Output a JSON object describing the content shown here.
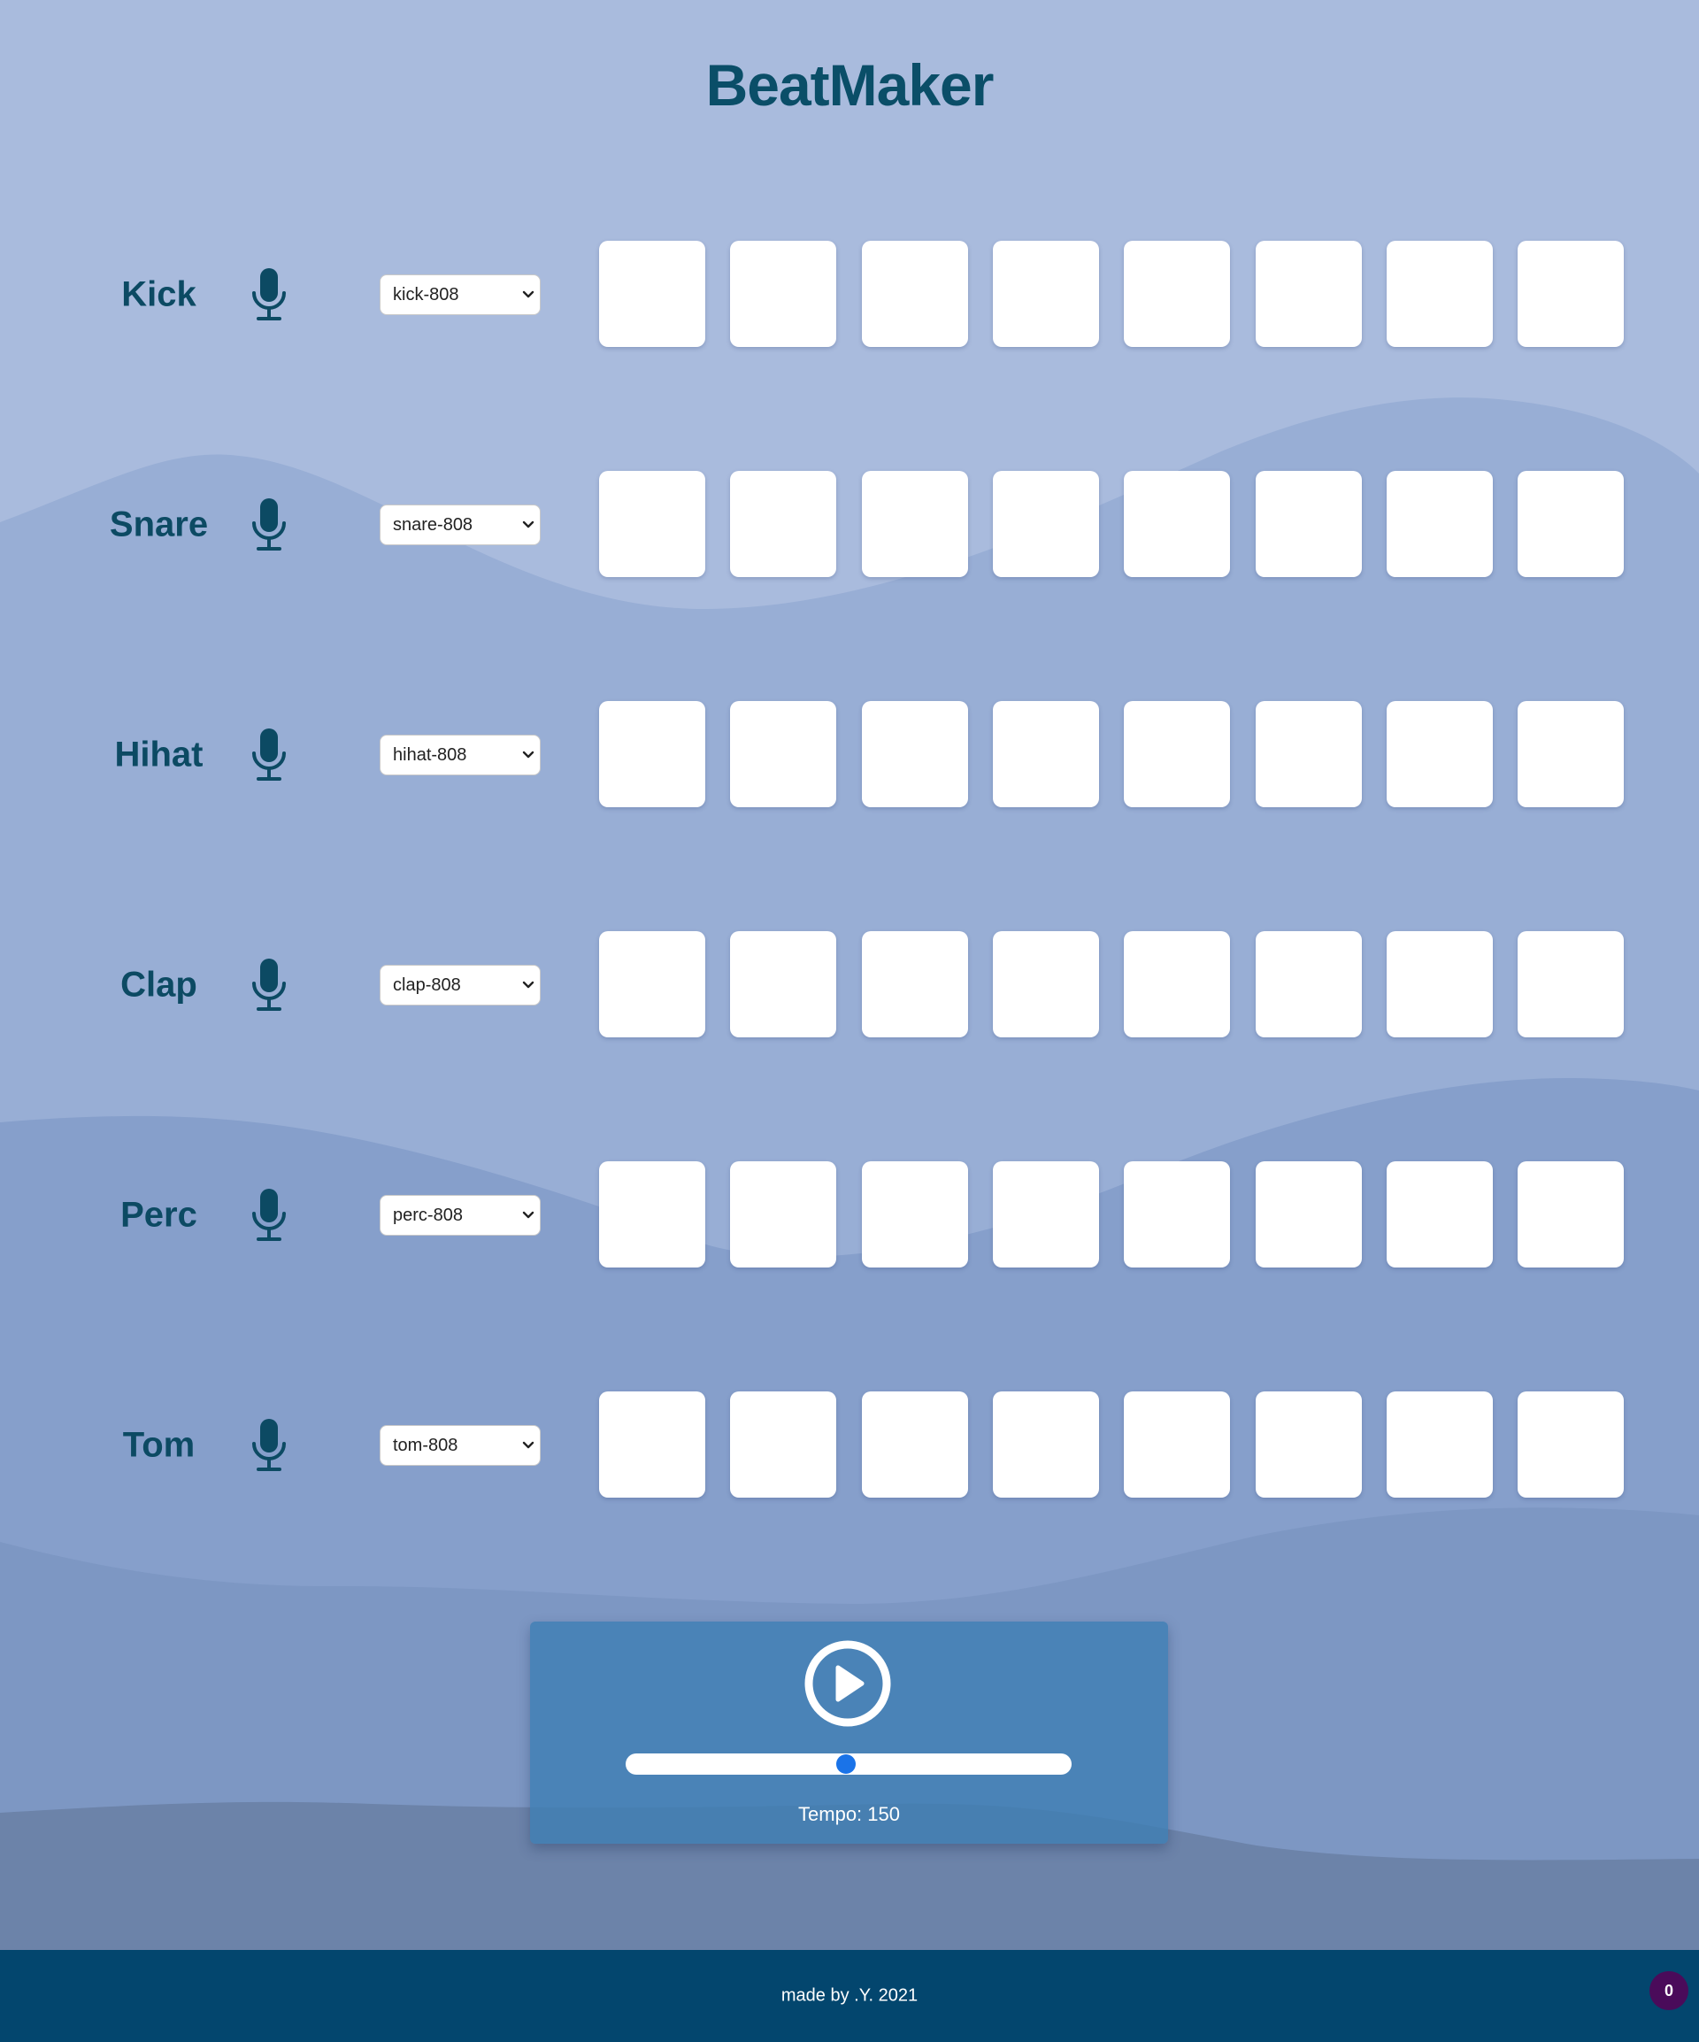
{
  "app": {
    "title": "BeatMaker"
  },
  "tracks": [
    {
      "name": "Kick",
      "sample": "kick-808",
      "active_steps": []
    },
    {
      "name": "Snare",
      "sample": "snare-808",
      "active_steps": []
    },
    {
      "name": "Hihat",
      "sample": "hihat-808",
      "active_steps": []
    },
    {
      "name": "Clap",
      "sample": "clap-808",
      "active_steps": []
    },
    {
      "name": "Perc",
      "sample": "perc-808",
      "active_steps": []
    },
    {
      "name": "Tom",
      "sample": "tom-808",
      "active_steps": []
    }
  ],
  "steps_per_track": 8,
  "icons": {
    "mute": "microphone-icon",
    "play": "play-icon",
    "select": "chevron-down-icon"
  },
  "controls": {
    "tempo_label": "Tempo: 150",
    "tempo_value": 150,
    "tempo_slider_fraction": 0.495
  },
  "footer": {
    "credit": "made by .Y. 2021",
    "badge_count": "0"
  },
  "colors": {
    "title": "#0a4e68",
    "track_name": "#0c4a63",
    "footer_bg": "#03466e",
    "badge_bg": "#4a0b5a",
    "slider_thumb": "#1a73e8"
  }
}
